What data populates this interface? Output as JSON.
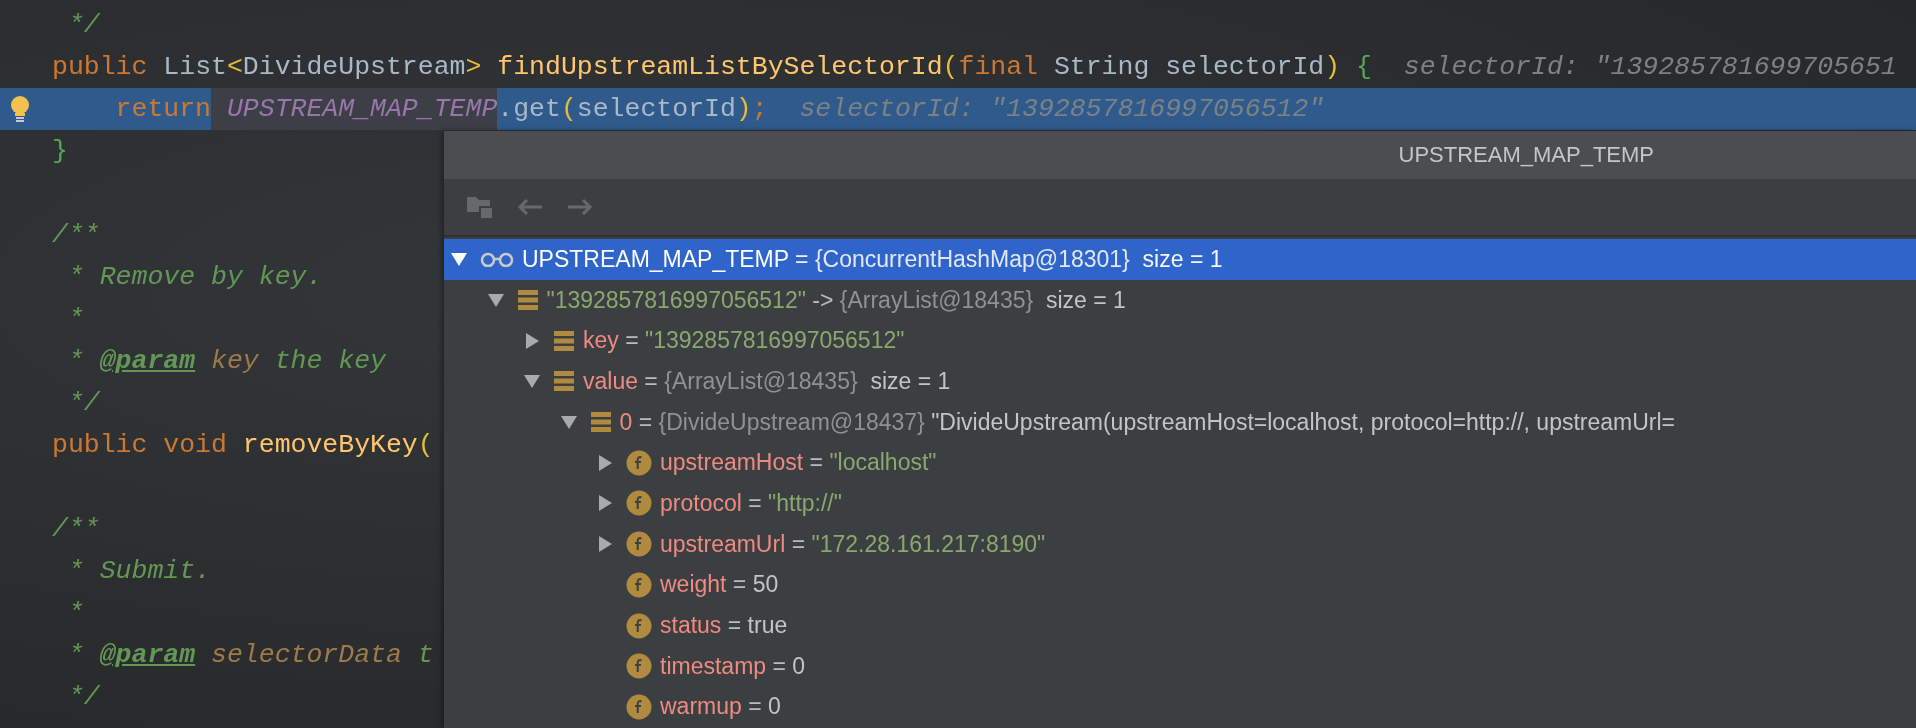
{
  "editor": {
    "lines": [
      {
        "selected": false,
        "bulb": false,
        "tokens": [
          {
            "kind": "comment",
            "text": " */"
          }
        ]
      },
      {
        "selected": false,
        "bulb": false,
        "tokens": [
          {
            "kind": "kw",
            "text": "public"
          },
          {
            "kind": "plain",
            "text": " List"
          },
          {
            "kind": "punct",
            "text": "<"
          },
          {
            "kind": "plain",
            "text": "DivideUpstream"
          },
          {
            "kind": "punct",
            "text": ">"
          },
          {
            "kind": "method",
            "text": " findUpstreamListBySelectorId"
          },
          {
            "kind": "punct",
            "text": "("
          },
          {
            "kind": "kw",
            "text": "final"
          },
          {
            "kind": "plain",
            "text": " String selectorId"
          },
          {
            "kind": "punct",
            "text": ")"
          },
          {
            "kind": "brace",
            "text": " {"
          },
          {
            "kind": "hint",
            "text": "  selectorId: \"139285781699705651"
          }
        ]
      },
      {
        "selected": true,
        "bulb": true,
        "tokens": [
          {
            "kind": "kw",
            "text": "    return"
          },
          {
            "kind": "static-usage",
            "text": " UPSTREAM_MAP_TEMP"
          },
          {
            "kind": "plain",
            "text": ".get"
          },
          {
            "kind": "punct",
            "text": "("
          },
          {
            "kind": "plain",
            "text": "selectorId"
          },
          {
            "kind": "punct",
            "text": ")"
          },
          {
            "kind": "kw",
            "text": ";"
          },
          {
            "kind": "hint",
            "text": "  selectorId: \"1392857816997056512\""
          }
        ]
      },
      {
        "selected": false,
        "bulb": false,
        "tokens": [
          {
            "kind": "brace",
            "text": "}"
          }
        ]
      },
      {
        "selected": false,
        "bulb": false
      },
      {
        "selected": false,
        "bulb": false,
        "tokens": [
          {
            "kind": "comment",
            "text": "/**"
          }
        ]
      },
      {
        "selected": false,
        "bulb": false,
        "tokens": [
          {
            "kind": "comment",
            "text": " * Remove by key."
          }
        ]
      },
      {
        "selected": false,
        "bulb": false,
        "tokens": [
          {
            "kind": "comment",
            "text": " *"
          }
        ]
      },
      {
        "selected": false,
        "bulb": false,
        "tokens": [
          {
            "kind": "comment",
            "text": " * "
          },
          {
            "kind": "tag",
            "text": "@param"
          },
          {
            "kind": "docparam",
            "text": " key"
          },
          {
            "kind": "comment",
            "text": " the key"
          }
        ]
      },
      {
        "selected": false,
        "bulb": false,
        "tokens": [
          {
            "kind": "comment",
            "text": " */"
          }
        ]
      },
      {
        "selected": false,
        "bulb": false,
        "tokens": [
          {
            "kind": "kw",
            "text": "public void"
          },
          {
            "kind": "method",
            "text": " removeByKey"
          },
          {
            "kind": "punct",
            "text": "("
          }
        ]
      },
      {
        "selected": false,
        "bulb": false
      },
      {
        "selected": false,
        "bulb": false,
        "tokens": [
          {
            "kind": "comment",
            "text": "/**"
          }
        ]
      },
      {
        "selected": false,
        "bulb": false,
        "tokens": [
          {
            "kind": "comment",
            "text": " * Submit."
          }
        ]
      },
      {
        "selected": false,
        "bulb": false,
        "tokens": [
          {
            "kind": "comment",
            "text": " *"
          }
        ]
      },
      {
        "selected": false,
        "bulb": false,
        "tokens": [
          {
            "kind": "comment",
            "text": " * "
          },
          {
            "kind": "tag",
            "text": "@param"
          },
          {
            "kind": "docparam",
            "text": " selectorData"
          },
          {
            "kind": "comment",
            "text": " t"
          }
        ]
      },
      {
        "selected": false,
        "bulb": false,
        "tokens": [
          {
            "kind": "comment",
            "text": " */"
          }
        ]
      }
    ]
  },
  "popup": {
    "title": "UPSTREAM_MAP_TEMP",
    "toolbar": [
      {
        "kind": "frames",
        "disabled": true
      },
      {
        "kind": "back",
        "disabled": true
      },
      {
        "kind": "forward",
        "disabled": true
      }
    ],
    "tree": [
      {
        "kind": "watch",
        "expanded": true,
        "selected": true,
        "parts": [
          {
            "kind": "name",
            "text": "UPSTREAM_MAP_TEMP"
          },
          {
            "kind": "op",
            "text": " = "
          },
          {
            "kind": "ref",
            "text": "{ConcurrentHashMap@18301}"
          },
          {
            "kind": "plain",
            "text": "  size = 1"
          }
        ],
        "children": [
          {
            "kind": "entry",
            "expanded": true,
            "selected": false,
            "parts": [
              {
                "kind": "string",
                "text": "\"1392857816997056512\""
              },
              {
                "kind": "op",
                "text": " -> "
              },
              {
                "kind": "ref",
                "text": "{ArrayList@18435}"
              },
              {
                "kind": "plain",
                "text": "  size = 1"
              }
            ],
            "children": [
              {
                "kind": "entry",
                "expanded": false,
                "selected": false,
                "parts": [
                  {
                    "kind": "name",
                    "text": "key"
                  },
                  {
                    "kind": "op",
                    "text": " = "
                  },
                  {
                    "kind": "string",
                    "text": "\"1392857816997056512\""
                  }
                ]
              },
              {
                "kind": "entry",
                "expanded": true,
                "selected": false,
                "parts": [
                  {
                    "kind": "name",
                    "text": "value"
                  },
                  {
                    "kind": "op",
                    "text": " = "
                  },
                  {
                    "kind": "ref",
                    "text": "{ArrayList@18435}"
                  },
                  {
                    "kind": "plain",
                    "text": "  size = 1"
                  }
                ],
                "children": [
                  {
                    "kind": "entry",
                    "expanded": true,
                    "selected": false,
                    "parts": [
                      {
                        "kind": "name",
                        "text": "0"
                      },
                      {
                        "kind": "op",
                        "text": " = "
                      },
                      {
                        "kind": "ref",
                        "text": "{DivideUpstream@18437}"
                      },
                      {
                        "kind": "plain",
                        "text": " \"DivideUpstream(upstreamHost=localhost, protocol=http://, upstreamUrl="
                      }
                    ],
                    "children": [
                      {
                        "kind": "field",
                        "expanded": false,
                        "selected": false,
                        "parts": [
                          {
                            "kind": "name",
                            "text": "upstreamHost"
                          },
                          {
                            "kind": "op",
                            "text": " = "
                          },
                          {
                            "kind": "string",
                            "text": "\"localhost\""
                          }
                        ]
                      },
                      {
                        "kind": "field",
                        "expanded": false,
                        "selected": false,
                        "parts": [
                          {
                            "kind": "name",
                            "text": "protocol"
                          },
                          {
                            "kind": "op",
                            "text": " = "
                          },
                          {
                            "kind": "string",
                            "text": "\"http://\""
                          }
                        ]
                      },
                      {
                        "kind": "field",
                        "expanded": false,
                        "selected": false,
                        "parts": [
                          {
                            "kind": "name",
                            "text": "upstreamUrl"
                          },
                          {
                            "kind": "op",
                            "text": " = "
                          },
                          {
                            "kind": "string",
                            "text": "\"172.28.161.217:8190\""
                          }
                        ]
                      },
                      {
                        "kind": "field",
                        "selected": false,
                        "parts": [
                          {
                            "kind": "name",
                            "text": "weight"
                          },
                          {
                            "kind": "op",
                            "text": " = "
                          },
                          {
                            "kind": "plain",
                            "text": "50"
                          }
                        ]
                      },
                      {
                        "kind": "field",
                        "selected": false,
                        "parts": [
                          {
                            "kind": "name",
                            "text": "status"
                          },
                          {
                            "kind": "op",
                            "text": " = "
                          },
                          {
                            "kind": "plain",
                            "text": "true"
                          }
                        ]
                      },
                      {
                        "kind": "field",
                        "selected": false,
                        "parts": [
                          {
                            "kind": "name",
                            "text": "timestamp"
                          },
                          {
                            "kind": "op",
                            "text": " = "
                          },
                          {
                            "kind": "plain",
                            "text": "0"
                          }
                        ]
                      },
                      {
                        "kind": "field",
                        "selected": false,
                        "parts": [
                          {
                            "kind": "name",
                            "text": "warmup"
                          },
                          {
                            "kind": "op",
                            "text": " = "
                          },
                          {
                            "kind": "plain",
                            "text": "0"
                          }
                        ]
                      }
                    ]
                  }
                ]
              }
            ]
          }
        ]
      }
    ]
  }
}
